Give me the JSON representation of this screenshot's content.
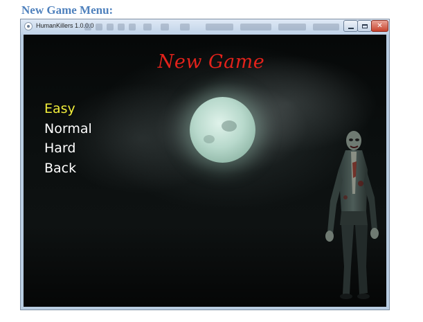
{
  "caption": "New Game Menu:",
  "window": {
    "title": "HumanKillers 1.0.0.0",
    "controls": {
      "minimize": "minimize-icon",
      "maximize": "maximize-icon",
      "close": "close-icon",
      "close_glyph": "✕"
    }
  },
  "game": {
    "title": "New Game",
    "menu": [
      {
        "label": "Easy",
        "selected": true
      },
      {
        "label": "Normal",
        "selected": false
      },
      {
        "label": "Hard",
        "selected": false
      },
      {
        "label": "Back",
        "selected": false
      }
    ]
  },
  "colors": {
    "caption": "#4f81bd",
    "title": "#e3221b",
    "selected_item": "#f2ee3a",
    "menu_item": "#ffffff",
    "background": "#0b0f0f"
  }
}
